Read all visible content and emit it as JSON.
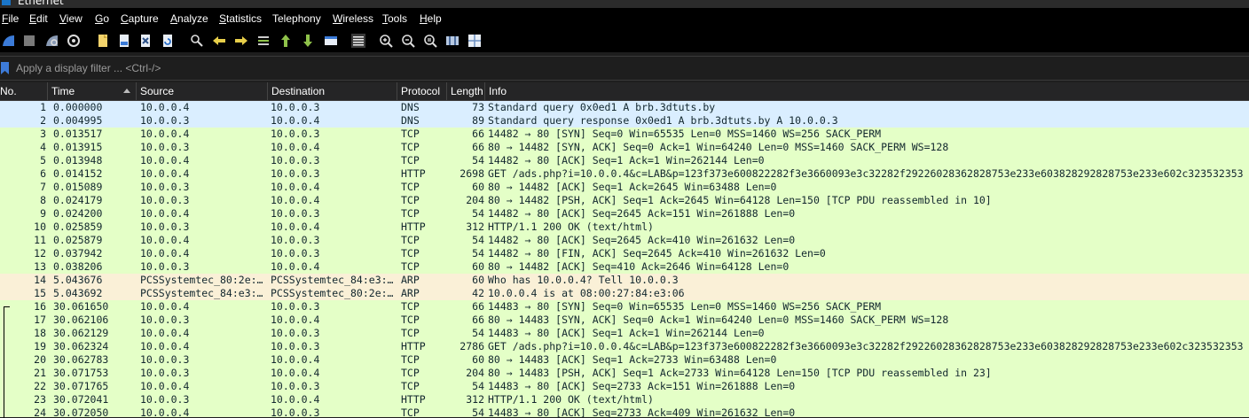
{
  "window": {
    "title": "Ethernet"
  },
  "menu": [
    {
      "label": "File",
      "u": "F",
      "rest": "ile"
    },
    {
      "label": "Edit",
      "u": "E",
      "rest": "dit"
    },
    {
      "label": "View",
      "u": "V",
      "rest": "iew"
    },
    {
      "label": "Go",
      "u": "G",
      "rest": "o"
    },
    {
      "label": "Capture",
      "u": "C",
      "rest": "apture"
    },
    {
      "label": "Analyze",
      "u": "A",
      "rest": "nalyze"
    },
    {
      "label": "Statistics",
      "u": "S",
      "rest": "tatistics"
    },
    {
      "label": "Telephony",
      "u": "",
      "rest": "Telephony"
    },
    {
      "label": "Wireless",
      "u": "W",
      "rest": "ireless"
    },
    {
      "label": "Tools",
      "u": "T",
      "rest": "ools"
    },
    {
      "label": "Help",
      "u": "H",
      "rest": "elp"
    }
  ],
  "toolbar": {
    "icons": [
      "start-capture-icon",
      "stop-capture-icon",
      "restart-capture-icon",
      "capture-options-icon",
      "open-file-icon",
      "save-file-icon",
      "close-file-icon",
      "reload-file-icon",
      "find-packet-icon",
      "go-back-icon",
      "go-forward-icon",
      "go-to-packet-icon",
      "go-first-icon",
      "go-last-icon",
      "auto-scroll-icon",
      "colorize-icon",
      "zoom-in-icon",
      "zoom-out-icon",
      "normal-size-icon",
      "resize-columns-icon",
      "layout-icon"
    ]
  },
  "filter": {
    "placeholder": "Apply a display filter ... <Ctrl-/>"
  },
  "columns": {
    "no": "No.",
    "time": "Time",
    "source": "Source",
    "destination": "Destination",
    "protocol": "Protocol",
    "length": "Length",
    "info": "Info"
  },
  "colors": {
    "dns": "#daeeff",
    "tcp_http": "#e4ffc7",
    "arp": "#faf0d7",
    "row_text": "#12272e"
  },
  "packets": [
    {
      "no": "1",
      "time": "0.000000",
      "src": "10.0.0.4",
      "dst": "10.0.0.3",
      "proto": "DNS",
      "len": "73",
      "info": "Standard query 0x0ed1 A brb.3dtuts.by",
      "kind": "dns"
    },
    {
      "no": "2",
      "time": "0.004995",
      "src": "10.0.0.3",
      "dst": "10.0.0.4",
      "proto": "DNS",
      "len": "89",
      "info": "Standard query response 0x0ed1 A brb.3dtuts.by A 10.0.0.3",
      "kind": "dns"
    },
    {
      "no": "3",
      "time": "0.013517",
      "src": "10.0.0.4",
      "dst": "10.0.0.3",
      "proto": "TCP",
      "len": "66",
      "info": "14482 → 80 [SYN] Seq=0 Win=65535 Len=0 MSS=1460 WS=256 SACK_PERM",
      "kind": "tcp"
    },
    {
      "no": "4",
      "time": "0.013915",
      "src": "10.0.0.3",
      "dst": "10.0.0.4",
      "proto": "TCP",
      "len": "66",
      "info": "80 → 14482 [SYN, ACK] Seq=0 Ack=1 Win=64240 Len=0 MSS=1460 SACK_PERM WS=128",
      "kind": "tcp"
    },
    {
      "no": "5",
      "time": "0.013948",
      "src": "10.0.0.4",
      "dst": "10.0.0.3",
      "proto": "TCP",
      "len": "54",
      "info": "14482 → 80 [ACK] Seq=1 Ack=1 Win=262144 Len=0",
      "kind": "tcp"
    },
    {
      "no": "6",
      "time": "0.014152",
      "src": "10.0.0.4",
      "dst": "10.0.0.3",
      "proto": "HTTP",
      "len": "2698",
      "info": "GET /ads.php?i=10.0.0.4&c=LAB&p=123f373e600822282f3e3660093e3c32282f29226028362828753e233e603828292828753e233e602c323532353",
      "kind": "tcp"
    },
    {
      "no": "7",
      "time": "0.015089",
      "src": "10.0.0.3",
      "dst": "10.0.0.4",
      "proto": "TCP",
      "len": "60",
      "info": "80 → 14482 [ACK] Seq=1 Ack=2645 Win=63488 Len=0",
      "kind": "tcp"
    },
    {
      "no": "8",
      "time": "0.024179",
      "src": "10.0.0.3",
      "dst": "10.0.0.4",
      "proto": "TCP",
      "len": "204",
      "info": "80 → 14482 [PSH, ACK] Seq=1 Ack=2645 Win=64128 Len=150 [TCP PDU reassembled in 10]",
      "kind": "tcp"
    },
    {
      "no": "9",
      "time": "0.024200",
      "src": "10.0.0.4",
      "dst": "10.0.0.3",
      "proto": "TCP",
      "len": "54",
      "info": "14482 → 80 [ACK] Seq=2645 Ack=151 Win=261888 Len=0",
      "kind": "tcp"
    },
    {
      "no": "10",
      "time": "0.025859",
      "src": "10.0.0.3",
      "dst": "10.0.0.4",
      "proto": "HTTP",
      "len": "312",
      "info": "HTTP/1.1 200 OK  (text/html)",
      "kind": "tcp"
    },
    {
      "no": "11",
      "time": "0.025879",
      "src": "10.0.0.4",
      "dst": "10.0.0.3",
      "proto": "TCP",
      "len": "54",
      "info": "14482 → 80 [ACK] Seq=2645 Ack=410 Win=261632 Len=0",
      "kind": "tcp"
    },
    {
      "no": "12",
      "time": "0.037942",
      "src": "10.0.0.4",
      "dst": "10.0.0.3",
      "proto": "TCP",
      "len": "54",
      "info": "14482 → 80 [FIN, ACK] Seq=2645 Ack=410 Win=261632 Len=0",
      "kind": "tcp"
    },
    {
      "no": "13",
      "time": "0.038206",
      "src": "10.0.0.3",
      "dst": "10.0.0.4",
      "proto": "TCP",
      "len": "60",
      "info": "80 → 14482 [ACK] Seq=410 Ack=2646 Win=64128 Len=0",
      "kind": "tcp"
    },
    {
      "no": "14",
      "time": "5.043676",
      "src": "PCSSystemtec_80:2e:…",
      "dst": "PCSSystemtec_84:e3:…",
      "proto": "ARP",
      "len": "60",
      "info": "Who has 10.0.0.4? Tell 10.0.0.3",
      "kind": "arp"
    },
    {
      "no": "15",
      "time": "5.043692",
      "src": "PCSSystemtec_84:e3:…",
      "dst": "PCSSystemtec_80:2e:…",
      "proto": "ARP",
      "len": "42",
      "info": "10.0.0.4 is at 08:00:27:84:e3:06",
      "kind": "arp"
    },
    {
      "no": "16",
      "time": "30.061650",
      "src": "10.0.0.4",
      "dst": "10.0.0.3",
      "proto": "TCP",
      "len": "66",
      "info": "14483 → 80 [SYN] Seq=0 Win=65535 Len=0 MSS=1460 WS=256 SACK_PERM",
      "kind": "tcp"
    },
    {
      "no": "17",
      "time": "30.062106",
      "src": "10.0.0.3",
      "dst": "10.0.0.4",
      "proto": "TCP",
      "len": "66",
      "info": "80 → 14483 [SYN, ACK] Seq=0 Ack=1 Win=64240 Len=0 MSS=1460 SACK_PERM WS=128",
      "kind": "tcp"
    },
    {
      "no": "18",
      "time": "30.062129",
      "src": "10.0.0.4",
      "dst": "10.0.0.3",
      "proto": "TCP",
      "len": "54",
      "info": "14483 → 80 [ACK] Seq=1 Ack=1 Win=262144 Len=0",
      "kind": "tcp"
    },
    {
      "no": "19",
      "time": "30.062324",
      "src": "10.0.0.4",
      "dst": "10.0.0.3",
      "proto": "HTTP",
      "len": "2786",
      "info": "GET /ads.php?i=10.0.0.4&c=LAB&p=123f373e600822282f3e3660093e3c32282f29226028362828753e233e603828292828753e233e602c323532353",
      "kind": "tcp"
    },
    {
      "no": "20",
      "time": "30.062783",
      "src": "10.0.0.3",
      "dst": "10.0.0.4",
      "proto": "TCP",
      "len": "60",
      "info": "80 → 14483 [ACK] Seq=1 Ack=2733 Win=63488 Len=0",
      "kind": "tcp"
    },
    {
      "no": "21",
      "time": "30.071753",
      "src": "10.0.0.3",
      "dst": "10.0.0.4",
      "proto": "TCP",
      "len": "204",
      "info": "80 → 14483 [PSH, ACK] Seq=1 Ack=2733 Win=64128 Len=150 [TCP PDU reassembled in 23]",
      "kind": "tcp"
    },
    {
      "no": "22",
      "time": "30.071765",
      "src": "10.0.0.4",
      "dst": "10.0.0.3",
      "proto": "TCP",
      "len": "54",
      "info": "14483 → 80 [ACK] Seq=2733 Ack=151 Win=261888 Len=0",
      "kind": "tcp"
    },
    {
      "no": "23",
      "time": "30.072041",
      "src": "10.0.0.3",
      "dst": "10.0.0.4",
      "proto": "HTTP",
      "len": "312",
      "info": "HTTP/1.1 200 OK  (text/html)",
      "kind": "tcp"
    },
    {
      "no": "24",
      "time": "30.072050",
      "src": "10.0.0.4",
      "dst": "10.0.0.3",
      "proto": "TCP",
      "len": "54",
      "info": "14483 → 80 [ACK] Seq=2733 Ack=409 Win=261632 Len=0",
      "kind": "tcp"
    }
  ]
}
